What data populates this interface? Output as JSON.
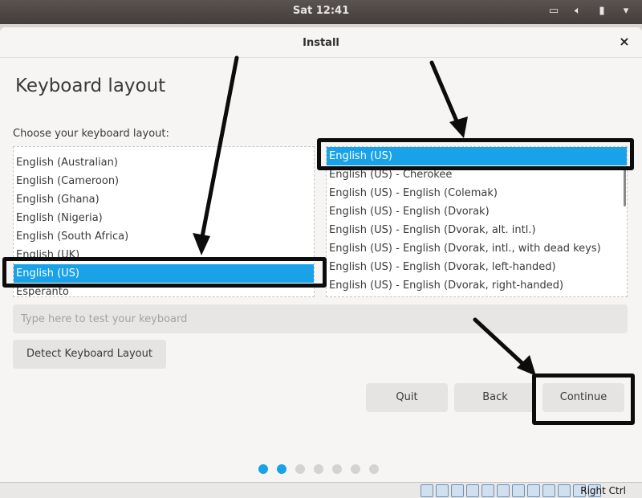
{
  "topbar": {
    "clock": "Sat 12:41",
    "tray_icons": [
      "screen-icon",
      "volume-icon",
      "battery-icon",
      "menu-arrow-icon"
    ]
  },
  "dialog": {
    "title": "Install",
    "close_glyph": "×"
  },
  "page": {
    "heading": "Keyboard layout",
    "choose_label": "Choose your keyboard layout:"
  },
  "layouts": {
    "items": [
      "English (Australian)",
      "English (Cameroon)",
      "English (Ghana)",
      "English (Nigeria)",
      "English (South Africa)",
      "English (UK)",
      "English (US)",
      "Esperanto"
    ],
    "selected": "English (US)"
  },
  "variants": {
    "items": [
      "English (US)",
      "English (US) - Cherokee",
      "English (US) - English (Colemak)",
      "English (US) - English (Dvorak)",
      "English (US) - English (Dvorak, alt. intl.)",
      "English (US) - English (Dvorak, intl., with dead keys)",
      "English (US) - English (Dvorak, left-handed)",
      "English (US) - English (Dvorak, right-handed)"
    ],
    "selected": "English (US)"
  },
  "test_input": {
    "placeholder": "Type here to test your keyboard",
    "value": ""
  },
  "buttons": {
    "detect": "Detect Keyboard Layout",
    "quit": "Quit",
    "back": "Back",
    "continue": "Continue"
  },
  "progress": {
    "total_steps": 7,
    "completed_steps": 2
  },
  "statusbar": {
    "host_key": "Right Ctrl"
  },
  "colors": {
    "accent": "#19a2e8",
    "topbar": "#4d4745",
    "annotation": "#0c0c0c"
  }
}
